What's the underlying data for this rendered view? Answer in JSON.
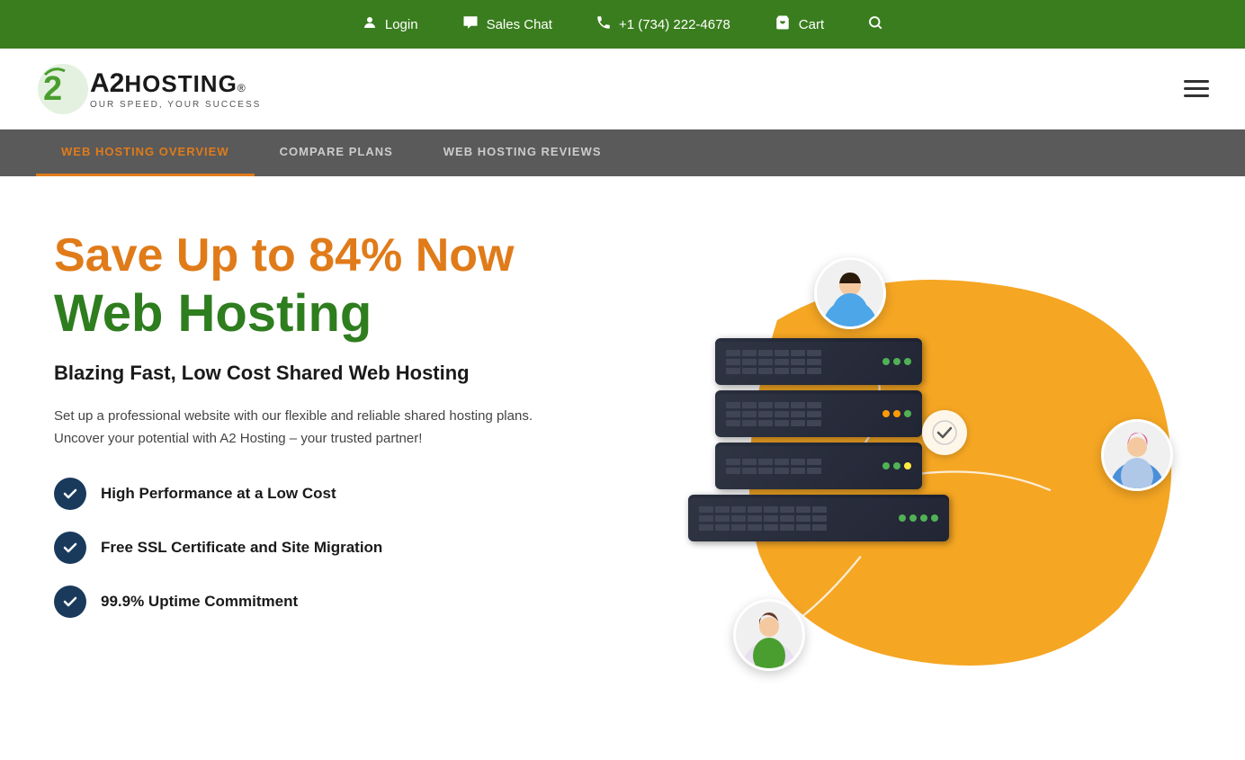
{
  "topbar": {
    "login_label": "Login",
    "chat_label": "Sales Chat",
    "phone_label": "+1 (734) 222-4678",
    "cart_label": "Cart"
  },
  "header": {
    "logo_a2": "A2",
    "logo_hosting": "HOSTING",
    "logo_registered": "®",
    "logo_tagline": "OUR SPEED, YOUR SUCCESS"
  },
  "subnav": {
    "items": [
      {
        "label": "WEB HOSTING OVERVIEW",
        "active": true
      },
      {
        "label": "COMPARE PLANS",
        "active": false
      },
      {
        "label": "WEB HOSTING REVIEWS",
        "active": false
      }
    ]
  },
  "hero": {
    "title_line1": "Save Up to 84% Now",
    "title_line2": "Web Hosting",
    "subtitle": "Blazing Fast, Low Cost Shared Web Hosting",
    "description": "Set up a professional website with our flexible and reliable shared hosting plans. Uncover your potential with A2 Hosting – your trusted partner!",
    "features": [
      "High Performance at a Low Cost",
      "Free SSL Certificate and Site Migration",
      "99.9% Uptime Commitment"
    ]
  }
}
